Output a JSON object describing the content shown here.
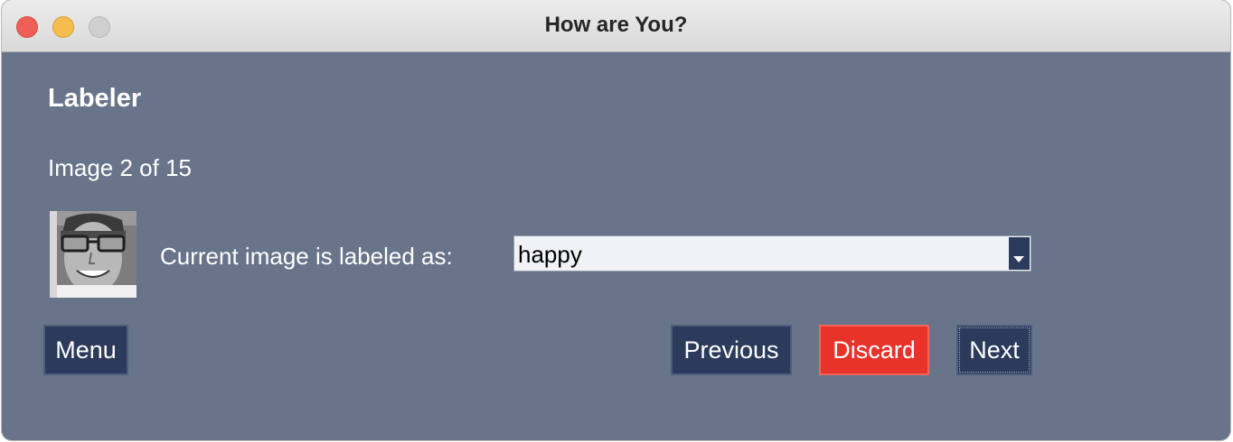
{
  "window": {
    "title": "How are You?"
  },
  "labeler": {
    "heading": "Labeler",
    "counter": "Image 2 of 15",
    "image": {
      "description_icon": "face-thumbnail"
    },
    "current_label_text": "Current image is labeled as:",
    "label_select": {
      "value": "happy"
    }
  },
  "buttons": {
    "menu": "Menu",
    "previous": "Previous",
    "discard": "Discard",
    "next": "Next"
  },
  "colors": {
    "background": "#677489",
    "button": "#2c3a5b",
    "discard": "#e8332a",
    "text": "#ffffff"
  }
}
